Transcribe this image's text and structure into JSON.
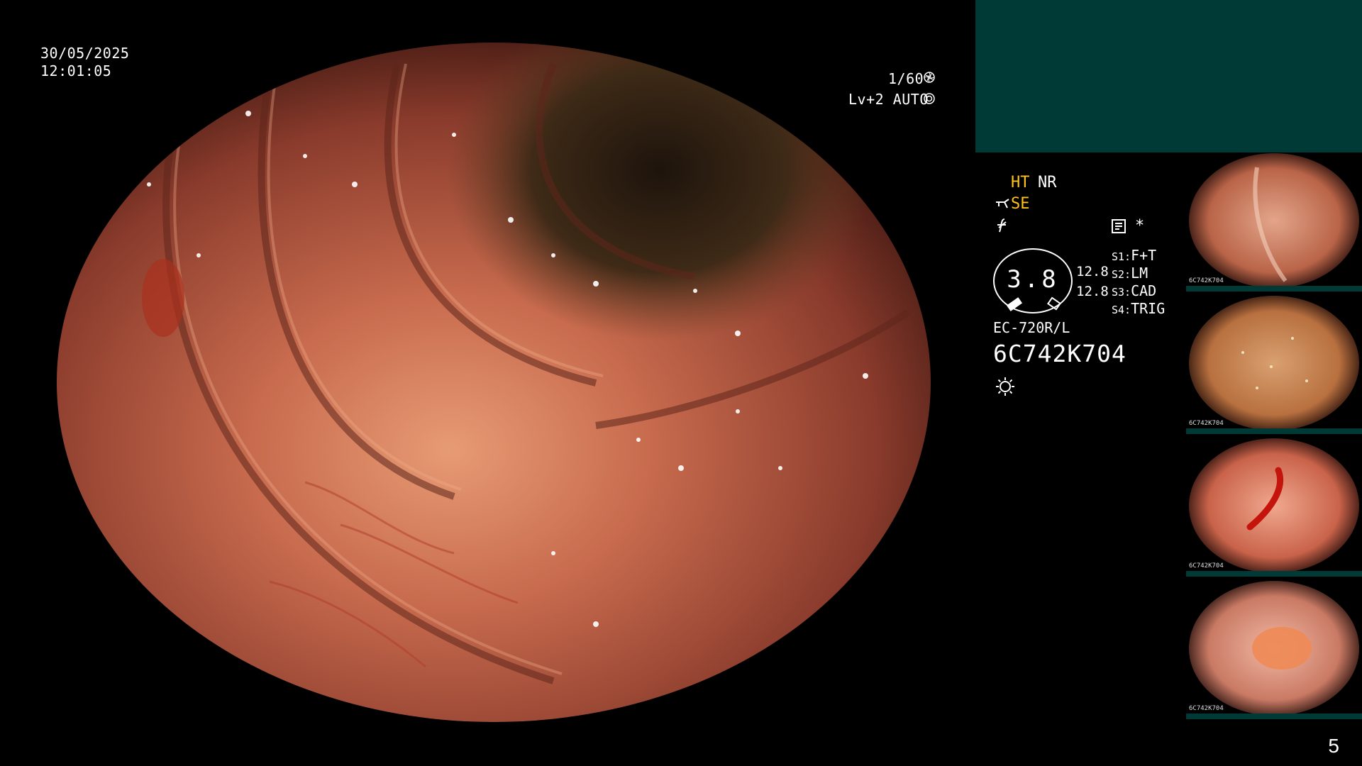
{
  "overlay": {
    "date": "30/05/2025",
    "time": "12:01:05",
    "shutter": "1/60",
    "level": "Lv+2 AUTO"
  },
  "status": {
    "ht": "HT",
    "nr": "NR",
    "se": "SE",
    "zoom_value": "3.8",
    "values": [
      "12.8",
      "12.8"
    ],
    "scope_model": "EC-720R/L",
    "scope_serial": "6C742K704",
    "switches": [
      {
        "key": "S1:",
        "value": "F+T"
      },
      {
        "key": "S2:",
        "value": "LM"
      },
      {
        "key": "S3:",
        "value": "CAD"
      },
      {
        "key": "S4:",
        "value": "TRIG"
      }
    ]
  },
  "thumbnails": [
    {
      "label": "6C742K704"
    },
    {
      "label": "6C742K704"
    },
    {
      "label": "6C742K704"
    },
    {
      "label": "6C742K704"
    }
  ],
  "page": {
    "number": "5"
  },
  "icons": {
    "shutter": "aperture-icon",
    "level": "auto-iris-icon",
    "se": "scope-tip-icon",
    "function": "function-icon",
    "memo": "memo-icon",
    "star": "asterisk-icon",
    "light": "light-icon"
  }
}
